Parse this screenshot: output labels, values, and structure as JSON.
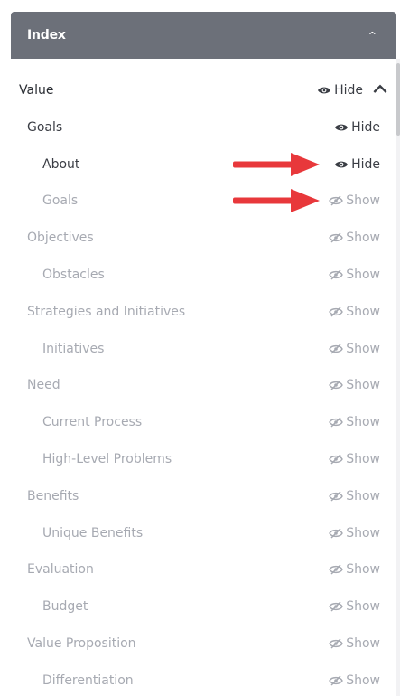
{
  "header": {
    "title": "Index",
    "toggle_icon": "chevron-up-icon"
  },
  "items": [
    {
      "label": "Value",
      "state": "Hide",
      "level": 0,
      "active": true,
      "chevron": "^"
    },
    {
      "label": "Goals",
      "state": "Hide",
      "level": 1,
      "active": true
    },
    {
      "label": "About",
      "state": "Hide",
      "level": 2,
      "active": true
    },
    {
      "label": "Goals",
      "state": "Show",
      "level": 2,
      "active": false
    },
    {
      "label": "Objectives",
      "state": "Show",
      "level": 1,
      "active": false
    },
    {
      "label": "Obstacles",
      "state": "Show",
      "level": 2,
      "active": false
    },
    {
      "label": "Strategies and Initiatives",
      "state": "Show",
      "level": 1,
      "active": false
    },
    {
      "label": "Initiatives",
      "state": "Show",
      "level": 2,
      "active": false
    },
    {
      "label": "Need",
      "state": "Show",
      "level": 1,
      "active": false
    },
    {
      "label": "Current Process",
      "state": "Show",
      "level": 2,
      "active": false
    },
    {
      "label": "High-Level Problems",
      "state": "Show",
      "level": 2,
      "active": false
    },
    {
      "label": "Benefits",
      "state": "Show",
      "level": 1,
      "active": false
    },
    {
      "label": "Unique Benefits",
      "state": "Show",
      "level": 2,
      "active": false
    },
    {
      "label": "Evaluation",
      "state": "Show",
      "level": 1,
      "active": false
    },
    {
      "label": "Budget",
      "state": "Show",
      "level": 2,
      "active": false
    },
    {
      "label": "Value Proposition",
      "state": "Show",
      "level": 1,
      "active": false
    },
    {
      "label": "Differentiation",
      "state": "Show",
      "level": 2,
      "active": false
    }
  ],
  "annotations": {
    "arrow_color": "#e8383b",
    "arrow_targets": [
      "About",
      "Goals"
    ]
  },
  "colors": {
    "header_bg": "#6c7079",
    "active_text": "#3a3d44",
    "dim_text": "#a7aab2"
  }
}
